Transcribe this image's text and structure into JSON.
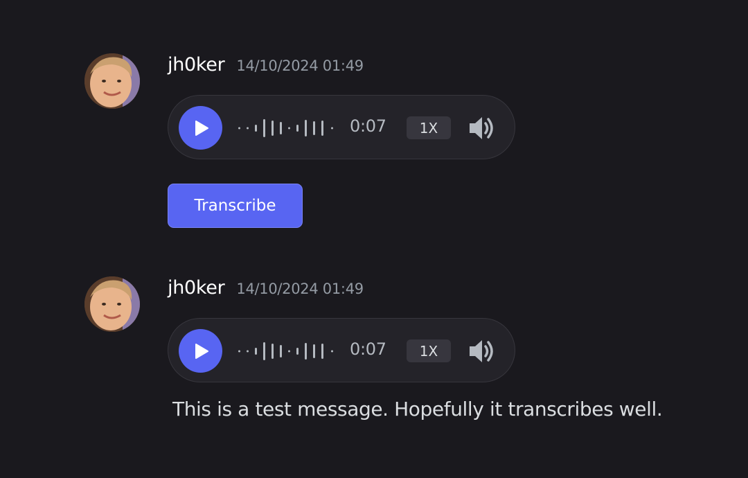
{
  "messages": [
    {
      "author": "jh0ker",
      "timestamp": "14/10/2024 01:49",
      "avatar_icon": "user-avatar",
      "voice": {
        "duration": "0:07",
        "speed": "1X",
        "play_icon": "play-icon",
        "volume_icon": "speaker-volume-icon"
      },
      "transcribe_label": "Transcribe"
    },
    {
      "author": "jh0ker",
      "timestamp": "14/10/2024 01:49",
      "avatar_icon": "user-avatar",
      "voice": {
        "duration": "0:07",
        "speed": "1X",
        "play_icon": "play-icon",
        "volume_icon": "speaker-volume-icon"
      },
      "transcript": "This is a test message. Hopefully it transcribes well."
    }
  ],
  "colors": {
    "background": "#1a191e",
    "accent": "#5865f2",
    "player_bg": "#242329",
    "muted_text": "#949ba4"
  }
}
